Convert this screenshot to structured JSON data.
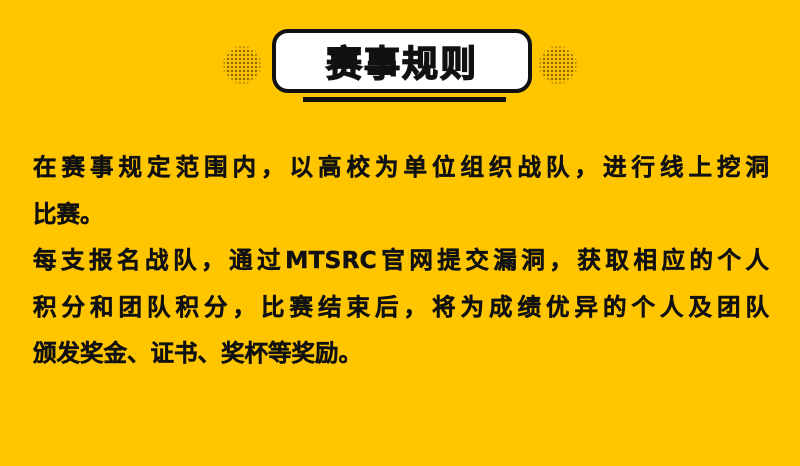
{
  "title": "赛事规则",
  "colors": {
    "background": "#FFC600",
    "text": "#111111",
    "title_box": "#FFFFFF"
  },
  "paragraphs": [
    {
      "lines": [
        "在赛事规定范围内，以高校为单位组织战队，进行线上挖洞",
        "比赛。"
      ]
    },
    {
      "lines": [
        "每支报名战队，通过MTSRC官网提交漏洞，获取相应的个人",
        "积分和团队积分，比赛结束后，将为成绩优异的个人及团队",
        "颁发奖金、证书、奖杯等奖励。"
      ]
    }
  ]
}
